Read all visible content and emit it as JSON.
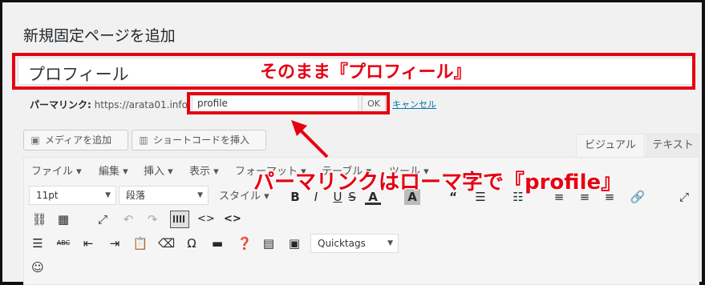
{
  "page_title": "新規固定ページを追加",
  "title_field": {
    "value": "プロフィール"
  },
  "permalink": {
    "label": "パーマリンク:",
    "base_url": "https://arata01.info",
    "slug_value": "profile",
    "ok_label": "OK",
    "cancel_label": "キャンセル"
  },
  "media_buttons": [
    {
      "label": "メディアを追加",
      "icon": "media-icon"
    },
    {
      "label": "ショートコードを挿入",
      "icon": "shortcode-icon"
    }
  ],
  "editor_tabs": [
    {
      "label": "ビジュアル",
      "active": true
    },
    {
      "label": "テキスト",
      "active": false
    }
  ],
  "menubar": [
    "ファイル ▾",
    "編集 ▾",
    "挿入 ▾",
    "表示 ▾",
    "フォーマット ▾",
    "テーブル ▾",
    "ツール ▾"
  ],
  "toolbar": {
    "font_size": "11pt",
    "block_format": "段落",
    "style_label": "スタイル ▾",
    "quicktags": "Quicktags"
  },
  "annotations": {
    "title_note": "そのまま『プロフィール』",
    "slug_note": "パーマリンクはローマ字で『profile』"
  },
  "colors": {
    "accent_red": "#e60012",
    "link_blue": "#0073aa"
  }
}
